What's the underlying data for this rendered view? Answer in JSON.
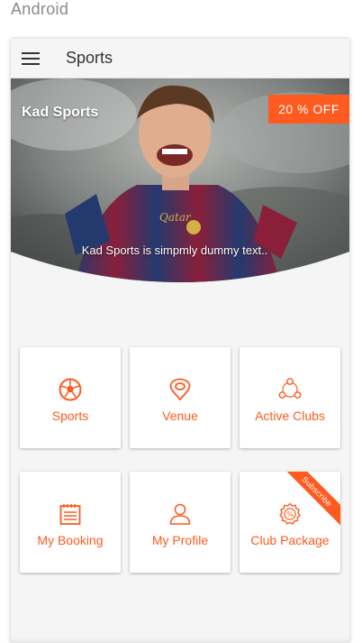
{
  "platform": "Android",
  "app_bar": {
    "title": "Sports"
  },
  "hero": {
    "title": "Kad Sports",
    "offer_badge": "20 % OFF",
    "caption": "Kad Sports is simpmly dummy text.."
  },
  "tiles": [
    {
      "label": "Sports",
      "icon": "soccer-ball-icon"
    },
    {
      "label": "Venue",
      "icon": "location-pin-icon"
    },
    {
      "label": "Active Clubs",
      "icon": "clubs-network-icon"
    },
    {
      "label": "My Booking",
      "icon": "calendar-list-icon"
    },
    {
      "label": "My Profile",
      "icon": "user-icon"
    },
    {
      "label": "Club Package",
      "icon": "percent-badge-icon",
      "ribbon": "Subscribe"
    }
  ],
  "colors": {
    "accent": "#ff5a1f",
    "background": "#f5f5f5",
    "tile": "#ffffff"
  }
}
